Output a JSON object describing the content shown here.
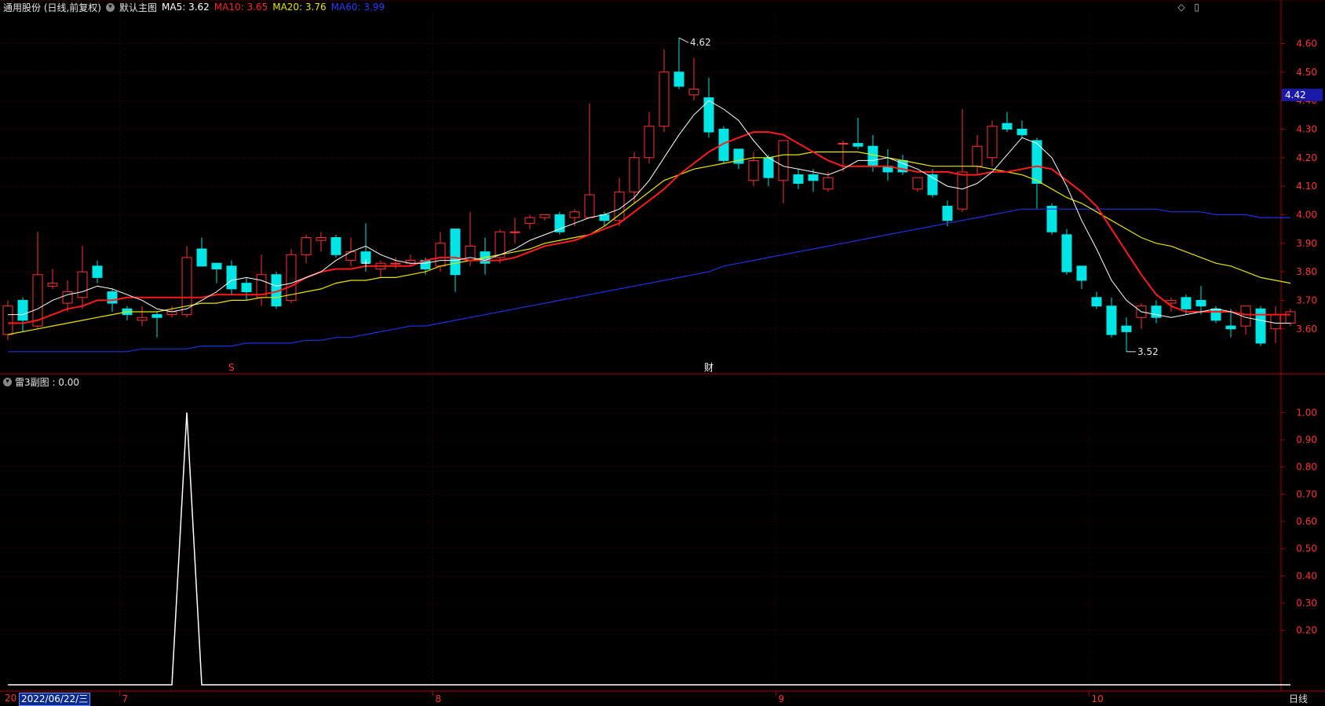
{
  "header": {
    "stock_name": "通用股份 (日线,前复权)",
    "main_chart": "默认主图",
    "ma5": "MA5: 3.62",
    "ma10": "MA10: 3.65",
    "ma20": "MA20: 3.76",
    "ma60": "MA60: 3.99",
    "icon_restore": "◇",
    "icon_window": "▯"
  },
  "sub_panel": {
    "title": "雷3副图 : 0.00"
  },
  "footer": {
    "date": "2022/06/22/三",
    "period_tab": "日线",
    "year_stub": "20"
  },
  "markers": {
    "s": "S",
    "cai": "财"
  },
  "colors": {
    "up": "#ff3333",
    "down": "#00e6e6",
    "ma5": "#ffffff",
    "ma10": "#ff1a1a",
    "ma20": "#e6e600",
    "ma60": "#2030e0",
    "axis": "#b00000",
    "label": "#ff3333"
  },
  "chart_data": [
    {
      "type": "candlestick",
      "title": "通用股份 (日线,前复权)",
      "ylim": [
        3.47,
        4.67
      ],
      "yticks": [
        "3.60",
        "3.70",
        "3.80",
        "3.90",
        "4.00",
        "4.10",
        "4.20",
        "4.30",
        "4.40",
        "4.50",
        "4.60"
      ],
      "current_price": "4.42",
      "high_label": "4.62",
      "low_label": "3.52",
      "x_month_labels": [
        {
          "index": 8,
          "label": "7"
        },
        {
          "index": 29,
          "label": "8"
        },
        {
          "index": 52,
          "label": "9"
        },
        {
          "index": 73,
          "label": "10"
        }
      ],
      "ohlc": [
        [
          3.58,
          3.68,
          3.56,
          3.7
        ],
        [
          3.7,
          3.63,
          3.59,
          3.71
        ],
        [
          3.61,
          3.79,
          3.6,
          3.94
        ],
        [
          3.75,
          3.76,
          3.74,
          3.81
        ],
        [
          3.69,
          3.73,
          3.66,
          3.77
        ],
        [
          3.71,
          3.8,
          3.67,
          3.89
        ],
        [
          3.82,
          3.78,
          3.76,
          3.84
        ],
        [
          3.73,
          3.69,
          3.66,
          3.74
        ],
        [
          3.67,
          3.65,
          3.63,
          3.68
        ],
        [
          3.63,
          3.64,
          3.61,
          3.68
        ],
        [
          3.65,
          3.64,
          3.57,
          3.66
        ],
        [
          3.65,
          3.66,
          3.64,
          3.68
        ],
        [
          3.65,
          3.85,
          3.64,
          3.89
        ],
        [
          3.88,
          3.82,
          3.82,
          3.92
        ],
        [
          3.83,
          3.81,
          3.76,
          3.83
        ],
        [
          3.82,
          3.74,
          3.72,
          3.84
        ],
        [
          3.76,
          3.73,
          3.7,
          3.78
        ],
        [
          3.71,
          3.79,
          3.68,
          3.86
        ],
        [
          3.79,
          3.68,
          3.67,
          3.8
        ],
        [
          3.7,
          3.86,
          3.69,
          3.88
        ],
        [
          3.86,
          3.92,
          3.83,
          3.93
        ],
        [
          3.91,
          3.92,
          3.87,
          3.94
        ],
        [
          3.92,
          3.86,
          3.85,
          3.93
        ],
        [
          3.84,
          3.87,
          3.82,
          3.92
        ],
        [
          3.87,
          3.83,
          3.8,
          3.97
        ],
        [
          3.81,
          3.83,
          3.78,
          3.84
        ],
        [
          3.83,
          3.83,
          3.81,
          3.85
        ],
        [
          3.83,
          3.84,
          3.82,
          3.86
        ],
        [
          3.84,
          3.81,
          3.79,
          3.85
        ],
        [
          3.82,
          3.9,
          3.8,
          3.94
        ],
        [
          3.95,
          3.79,
          3.73,
          3.95
        ],
        [
          3.84,
          3.89,
          3.82,
          4.01
        ],
        [
          3.87,
          3.83,
          3.79,
          3.92
        ],
        [
          3.85,
          3.94,
          3.83,
          3.95
        ],
        [
          3.94,
          3.94,
          3.9,
          3.99
        ],
        [
          3.97,
          3.99,
          3.95,
          4.0
        ],
        [
          3.99,
          4.0,
          3.98,
          4.0
        ],
        [
          4.0,
          3.94,
          3.93,
          4.01
        ],
        [
          3.99,
          4.01,
          3.96,
          4.02
        ],
        [
          3.99,
          4.07,
          3.99,
          4.39
        ],
        [
          4.0,
          3.98,
          3.96,
          4.01
        ],
        [
          3.98,
          4.08,
          3.96,
          4.13
        ],
        [
          4.08,
          4.2,
          4.04,
          4.22
        ],
        [
          4.2,
          4.31,
          4.18,
          4.36
        ],
        [
          4.31,
          4.5,
          4.29,
          4.58
        ],
        [
          4.5,
          4.45,
          4.44,
          4.62
        ],
        [
          4.42,
          4.44,
          4.4,
          4.55
        ],
        [
          4.41,
          4.29,
          4.27,
          4.48
        ],
        [
          4.3,
          4.19,
          4.18,
          4.31
        ],
        [
          4.23,
          4.18,
          4.16,
          4.23
        ],
        [
          4.12,
          4.19,
          4.1,
          4.22
        ],
        [
          4.2,
          4.13,
          4.1,
          4.21
        ],
        [
          4.12,
          4.26,
          4.04,
          4.26
        ],
        [
          4.14,
          4.11,
          4.09,
          4.16
        ],
        [
          4.14,
          4.12,
          4.08,
          4.16
        ],
        [
          4.09,
          4.13,
          4.08,
          4.15
        ],
        [
          4.25,
          4.25,
          4.15,
          4.26
        ],
        [
          4.25,
          4.24,
          4.23,
          4.34
        ],
        [
          4.24,
          4.17,
          4.15,
          4.28
        ],
        [
          4.17,
          4.15,
          4.12,
          4.23
        ],
        [
          4.19,
          4.15,
          4.14,
          4.21
        ],
        [
          4.09,
          4.13,
          4.08,
          4.13
        ],
        [
          4.14,
          4.07,
          4.06,
          4.16
        ],
        [
          4.03,
          3.98,
          3.96,
          4.05
        ],
        [
          4.02,
          4.15,
          4.01,
          4.37
        ],
        [
          4.17,
          4.24,
          4.14,
          4.28
        ],
        [
          4.2,
          4.31,
          4.17,
          4.33
        ],
        [
          4.32,
          4.3,
          4.29,
          4.36
        ],
        [
          4.3,
          4.28,
          4.27,
          4.33
        ],
        [
          4.26,
          4.11,
          4.02,
          4.27
        ],
        [
          4.03,
          3.94,
          3.93,
          4.04
        ],
        [
          3.93,
          3.8,
          3.79,
          3.95
        ],
        [
          3.82,
          3.77,
          3.74,
          3.82
        ],
        [
          3.71,
          3.68,
          3.67,
          3.73
        ],
        [
          3.68,
          3.58,
          3.57,
          3.71
        ],
        [
          3.61,
          3.59,
          3.52,
          3.64
        ],
        [
          3.64,
          3.68,
          3.6,
          3.69
        ],
        [
          3.68,
          3.64,
          3.62,
          3.7
        ],
        [
          3.69,
          3.7,
          3.66,
          3.71
        ],
        [
          3.71,
          3.67,
          3.65,
          3.72
        ],
        [
          3.7,
          3.68,
          3.65,
          3.75
        ],
        [
          3.67,
          3.63,
          3.62,
          3.68
        ],
        [
          3.61,
          3.6,
          3.57,
          3.67
        ],
        [
          3.61,
          3.68,
          3.58,
          3.68
        ],
        [
          3.67,
          3.55,
          3.54,
          3.68
        ],
        [
          3.6,
          3.65,
          3.55,
          3.68
        ],
        [
          3.62,
          3.66,
          3.61,
          3.67
        ]
      ],
      "ma5": [
        3.65,
        3.65,
        3.67,
        3.7,
        3.72,
        3.73,
        3.75,
        3.74,
        3.72,
        3.7,
        3.67,
        3.66,
        3.67,
        3.7,
        3.73,
        3.77,
        3.78,
        3.77,
        3.75,
        3.76,
        3.78,
        3.8,
        3.84,
        3.87,
        3.89,
        3.86,
        3.84,
        3.83,
        3.83,
        3.84,
        3.84,
        3.85,
        3.84,
        3.86,
        3.88,
        3.91,
        3.93,
        3.95,
        3.97,
        3.99,
        4.0,
        4.02,
        4.06,
        4.12,
        4.2,
        4.28,
        4.35,
        4.4,
        4.37,
        4.33,
        4.26,
        4.2,
        4.17,
        4.16,
        4.15,
        4.14,
        4.16,
        4.19,
        4.19,
        4.2,
        4.18,
        4.16,
        4.13,
        4.1,
        4.09,
        4.11,
        4.15,
        4.21,
        4.27,
        4.25,
        4.2,
        4.1,
        3.98,
        3.88,
        3.77,
        3.7,
        3.66,
        3.65,
        3.64,
        3.65,
        3.66,
        3.67,
        3.66,
        3.64,
        3.63,
        3.62,
        3.62
      ],
      "ma10": [
        3.62,
        3.62,
        3.63,
        3.65,
        3.67,
        3.68,
        3.7,
        3.7,
        3.71,
        3.71,
        3.71,
        3.71,
        3.71,
        3.71,
        3.72,
        3.72,
        3.72,
        3.72,
        3.73,
        3.75,
        3.78,
        3.8,
        3.81,
        3.81,
        3.82,
        3.82,
        3.82,
        3.82,
        3.84,
        3.85,
        3.85,
        3.84,
        3.84,
        3.84,
        3.85,
        3.87,
        3.89,
        3.9,
        3.91,
        3.93,
        3.95,
        3.97,
        4.01,
        4.05,
        4.09,
        4.14,
        4.18,
        4.22,
        4.25,
        4.27,
        4.29,
        4.29,
        4.28,
        4.25,
        4.22,
        4.19,
        4.17,
        4.17,
        4.17,
        4.17,
        4.16,
        4.15,
        4.15,
        4.15,
        4.14,
        4.14,
        4.15,
        4.15,
        4.16,
        4.17,
        4.16,
        4.12,
        4.08,
        4.03,
        3.95,
        3.87,
        3.79,
        3.72,
        3.68,
        3.66,
        3.66,
        3.66,
        3.66,
        3.65,
        3.65,
        3.65,
        3.65
      ],
      "ma20": [
        3.58,
        3.59,
        3.6,
        3.61,
        3.62,
        3.63,
        3.64,
        3.65,
        3.66,
        3.66,
        3.66,
        3.67,
        3.68,
        3.69,
        3.69,
        3.7,
        3.7,
        3.71,
        3.71,
        3.72,
        3.73,
        3.74,
        3.76,
        3.77,
        3.77,
        3.78,
        3.78,
        3.79,
        3.8,
        3.82,
        3.83,
        3.84,
        3.85,
        3.86,
        3.87,
        3.88,
        3.9,
        3.91,
        3.92,
        3.93,
        3.96,
        4.0,
        4.04,
        4.08,
        4.12,
        4.14,
        4.16,
        4.17,
        4.18,
        4.19,
        4.2,
        4.2,
        4.21,
        4.21,
        4.22,
        4.22,
        4.22,
        4.22,
        4.21,
        4.2,
        4.19,
        4.18,
        4.17,
        4.17,
        4.17,
        4.17,
        4.16,
        4.15,
        4.14,
        4.12,
        4.09,
        4.06,
        4.04,
        4.01,
        3.98,
        3.95,
        3.92,
        3.9,
        3.89,
        3.87,
        3.85,
        3.83,
        3.82,
        3.8,
        3.78,
        3.77,
        3.76
      ],
      "ma60": [
        3.52,
        3.52,
        3.52,
        3.52,
        3.52,
        3.52,
        3.52,
        3.52,
        3.52,
        3.53,
        3.53,
        3.53,
        3.53,
        3.54,
        3.54,
        3.54,
        3.55,
        3.55,
        3.55,
        3.55,
        3.56,
        3.56,
        3.57,
        3.57,
        3.58,
        3.59,
        3.6,
        3.61,
        3.61,
        3.62,
        3.63,
        3.64,
        3.65,
        3.66,
        3.67,
        3.68,
        3.69,
        3.7,
        3.71,
        3.72,
        3.73,
        3.74,
        3.75,
        3.76,
        3.77,
        3.78,
        3.79,
        3.8,
        3.82,
        3.83,
        3.84,
        3.85,
        3.86,
        3.87,
        3.88,
        3.89,
        3.9,
        3.91,
        3.92,
        3.93,
        3.94,
        3.95,
        3.96,
        3.97,
        3.98,
        3.99,
        4.0,
        4.01,
        4.02,
        4.02,
        4.02,
        4.02,
        4.02,
        4.02,
        4.02,
        4.02,
        4.02,
        4.02,
        4.01,
        4.01,
        4.01,
        4.0,
        4.0,
        4.0,
        3.99,
        3.99,
        3.99
      ]
    },
    {
      "type": "line",
      "title": "雷3副图 : 0.00",
      "ylim": [
        0.0,
        1.05
      ],
      "yticks": [
        "0.20",
        "0.30",
        "0.40",
        "0.50",
        "0.60",
        "0.70",
        "0.80",
        "0.90",
        "1.00"
      ],
      "series": [
        {
          "values": [
            0,
            0,
            0,
            0,
            0,
            0,
            0,
            0,
            0,
            0,
            0,
            0,
            1,
            0,
            0,
            0,
            0,
            0,
            0,
            0,
            0,
            0,
            0,
            0,
            0,
            0,
            0,
            0,
            0,
            0,
            0,
            0,
            0,
            0,
            0,
            0,
            0,
            0,
            0,
            0,
            0,
            0,
            0,
            0,
            0,
            0,
            0,
            0,
            0,
            0,
            0,
            0,
            0,
            0,
            0,
            0,
            0,
            0,
            0,
            0,
            0,
            0,
            0,
            0,
            0,
            0,
            0,
            0,
            0,
            0,
            0,
            0,
            0,
            0,
            0,
            0,
            0,
            0,
            0,
            0,
            0,
            0,
            0,
            0,
            0,
            0,
            0
          ]
        }
      ]
    }
  ]
}
